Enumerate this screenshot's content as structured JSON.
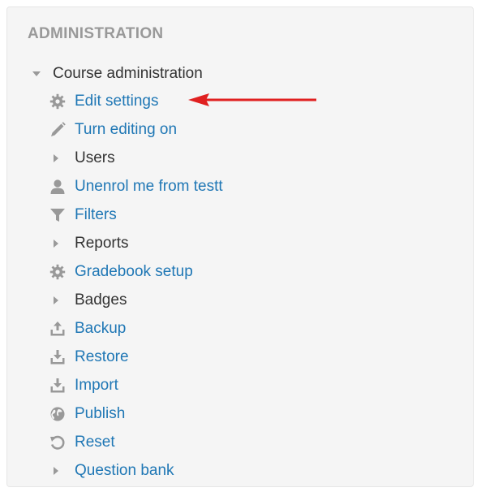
{
  "block": {
    "title": "ADMINISTRATION",
    "course_admin_label": "Course administration"
  },
  "items": [
    {
      "label": "Edit settings",
      "icon": "gear-icon",
      "kind": "link"
    },
    {
      "label": "Turn editing on",
      "icon": "pencil-icon",
      "kind": "link"
    },
    {
      "label": "Users",
      "icon": "caret-right-icon",
      "kind": "node"
    },
    {
      "label": "Unenrol me from testt",
      "icon": "user-icon",
      "kind": "link"
    },
    {
      "label": "Filters",
      "icon": "filter-icon",
      "kind": "link"
    },
    {
      "label": "Reports",
      "icon": "caret-right-icon",
      "kind": "node"
    },
    {
      "label": "Gradebook setup",
      "icon": "gear-icon",
      "kind": "link"
    },
    {
      "label": "Badges",
      "icon": "caret-right-icon",
      "kind": "node"
    },
    {
      "label": "Backup",
      "icon": "upload-icon",
      "kind": "link"
    },
    {
      "label": "Restore",
      "icon": "download-icon",
      "kind": "link"
    },
    {
      "label": "Import",
      "icon": "download-icon",
      "kind": "link"
    },
    {
      "label": "Publish",
      "icon": "globe-icon",
      "kind": "link"
    },
    {
      "label": "Reset",
      "icon": "reset-icon",
      "kind": "link"
    },
    {
      "label": "Question bank",
      "icon": "caret-right-icon",
      "kind": "link"
    }
  ],
  "colors": {
    "link": "#1f77b5",
    "text": "#333333",
    "title": "#999999",
    "icon": "#999999",
    "annotation_arrow": "#e02020"
  }
}
